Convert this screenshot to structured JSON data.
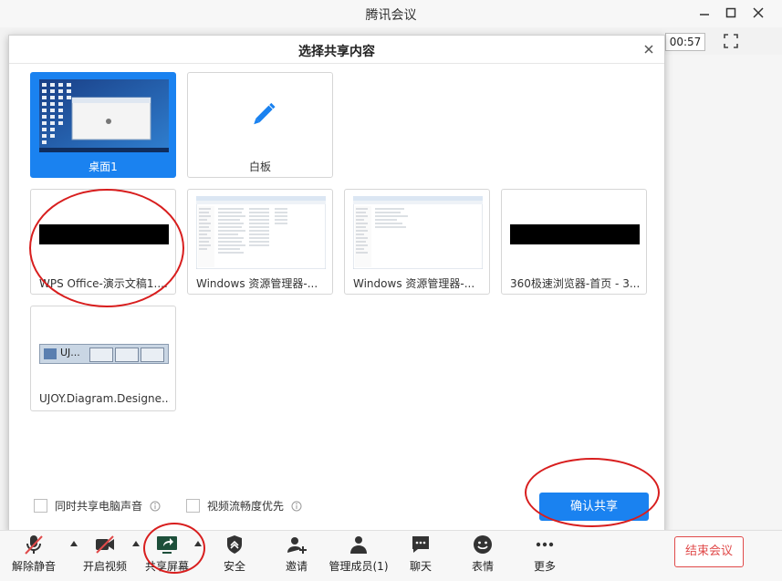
{
  "window": {
    "title": "腾讯会议",
    "timer": "00:57"
  },
  "dialog": {
    "title": "选择共享内容",
    "options": [
      {
        "label": "桌面1",
        "selected": true
      },
      {
        "label": "白板",
        "selected": false
      },
      {
        "label": "WPS Office-演示文稿1....",
        "selected": false
      },
      {
        "label": "Windows 资源管理器-...",
        "selected": false
      },
      {
        "label": "Windows 资源管理器-...",
        "selected": false
      },
      {
        "label": "360极速浏览器-首页 - 3...",
        "selected": false
      },
      {
        "label": "UJOY.Diagram.Designe...",
        "selected": false
      }
    ],
    "ujoy_thumb_title": "UJ...",
    "checkboxes": {
      "share_audio": "同时共享电脑声音",
      "video_smooth": "视频流畅度优先"
    },
    "confirm_label": "确认共享"
  },
  "toolbar": {
    "items": [
      {
        "label": "解除静音",
        "icon": "mic-muted-icon"
      },
      {
        "label": "开启视频",
        "icon": "camera-off-icon"
      },
      {
        "label": "共享屏幕",
        "icon": "share-screen-icon"
      },
      {
        "label": "安全",
        "icon": "shield-icon"
      },
      {
        "label": "邀请",
        "icon": "invite-icon"
      },
      {
        "label": "管理成员(1)",
        "icon": "members-icon"
      },
      {
        "label": "聊天",
        "icon": "chat-icon"
      },
      {
        "label": "表情",
        "icon": "emoji-icon"
      },
      {
        "label": "更多",
        "icon": "more-icon"
      }
    ],
    "end_label": "结束会议"
  },
  "colors": {
    "accent": "#1a82f0",
    "annotation": "#d81e1e",
    "end": "#e04a4a"
  }
}
